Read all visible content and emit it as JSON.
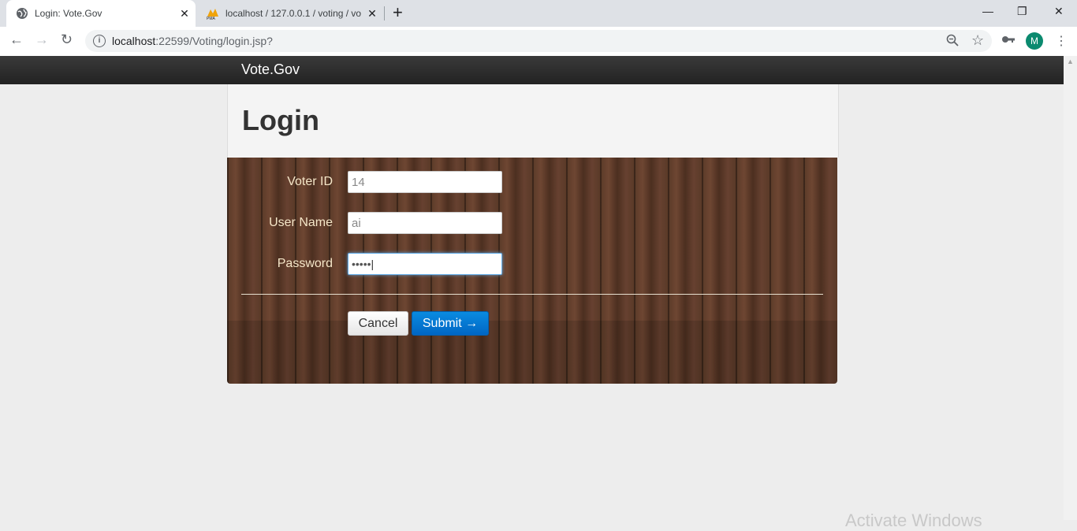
{
  "browser": {
    "tabs": [
      {
        "title": "Login: Vote.Gov",
        "active": true
      },
      {
        "title": "localhost / 127.0.0.1 / voting / vo",
        "active": false
      }
    ],
    "url_host": "localhost",
    "url_path": ":22599/Voting/login.jsp?",
    "profile_initial": "M"
  },
  "site": {
    "brand": "Vote.Gov"
  },
  "login": {
    "heading": "Login",
    "fields": [
      {
        "label": "Voter ID",
        "value": "14"
      },
      {
        "label": "User Name",
        "value": "ai"
      },
      {
        "label": "Password",
        "value": "•••••"
      }
    ],
    "cancel_label": "Cancel",
    "submit_label": "Submit →"
  },
  "os": {
    "watermark": "Activate Windows"
  },
  "colors": {
    "navbar": "#222222",
    "submit": "#0a7fd8",
    "label": "#f5e6c8"
  }
}
